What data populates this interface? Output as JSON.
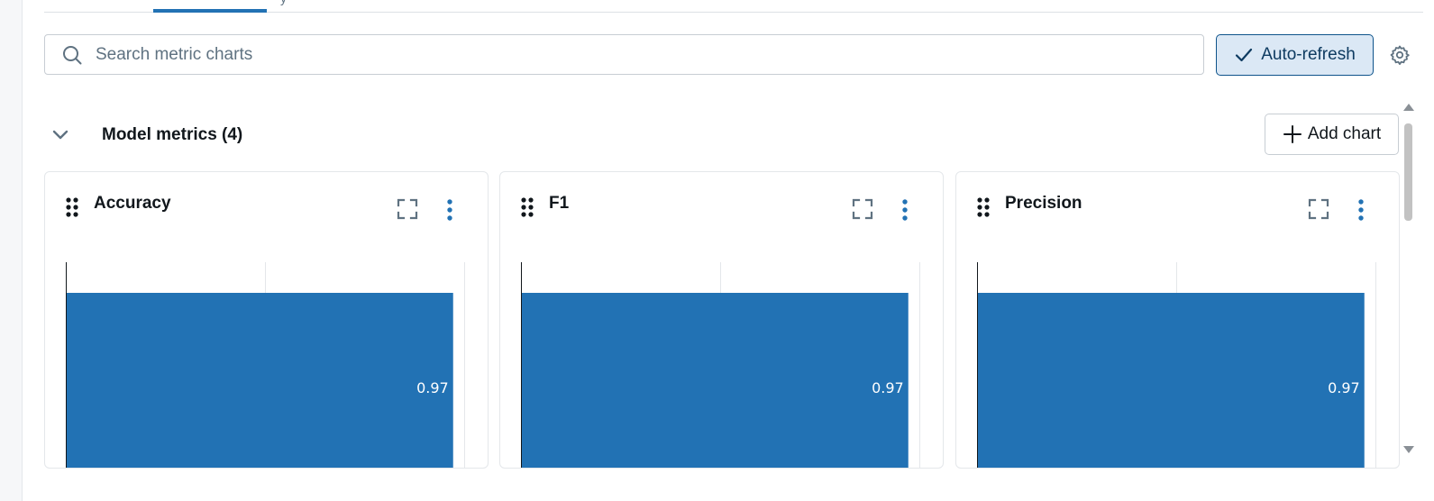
{
  "tabs": {
    "partial_label": "y"
  },
  "search": {
    "placeholder": "Search metric charts",
    "value": ""
  },
  "toolbar": {
    "auto_refresh_label": "Auto-refresh",
    "auto_refresh_checked": true,
    "settings_icon": "gear-icon"
  },
  "section": {
    "title": "Model metrics (4)",
    "collapse_icon": "chevron-down-icon",
    "add_chart_label": "Add chart"
  },
  "colors": {
    "accent": "#2272b4",
    "bar": "#2272b4",
    "toggle_bg": "#dbe8f5",
    "text": "#11171c",
    "muted": "#5f7281"
  },
  "cards": [
    {
      "title": "Accuracy"
    },
    {
      "title": "F1"
    },
    {
      "title": "Precision"
    }
  ],
  "chart_data": [
    {
      "type": "bar",
      "orientation": "horizontal",
      "title": "Accuracy",
      "categories": [
        ""
      ],
      "values": [
        0.97
      ],
      "data_labels": [
        "0.97"
      ],
      "xlim": [
        0,
        1
      ],
      "grid": true
    },
    {
      "type": "bar",
      "orientation": "horizontal",
      "title": "F1",
      "categories": [
        ""
      ],
      "values": [
        0.97
      ],
      "data_labels": [
        "0.97"
      ],
      "xlim": [
        0,
        1
      ],
      "grid": true
    },
    {
      "type": "bar",
      "orientation": "horizontal",
      "title": "Precision",
      "categories": [
        ""
      ],
      "values": [
        0.97
      ],
      "data_labels": [
        "0.97"
      ],
      "xlim": [
        0,
        1
      ],
      "grid": true
    }
  ]
}
